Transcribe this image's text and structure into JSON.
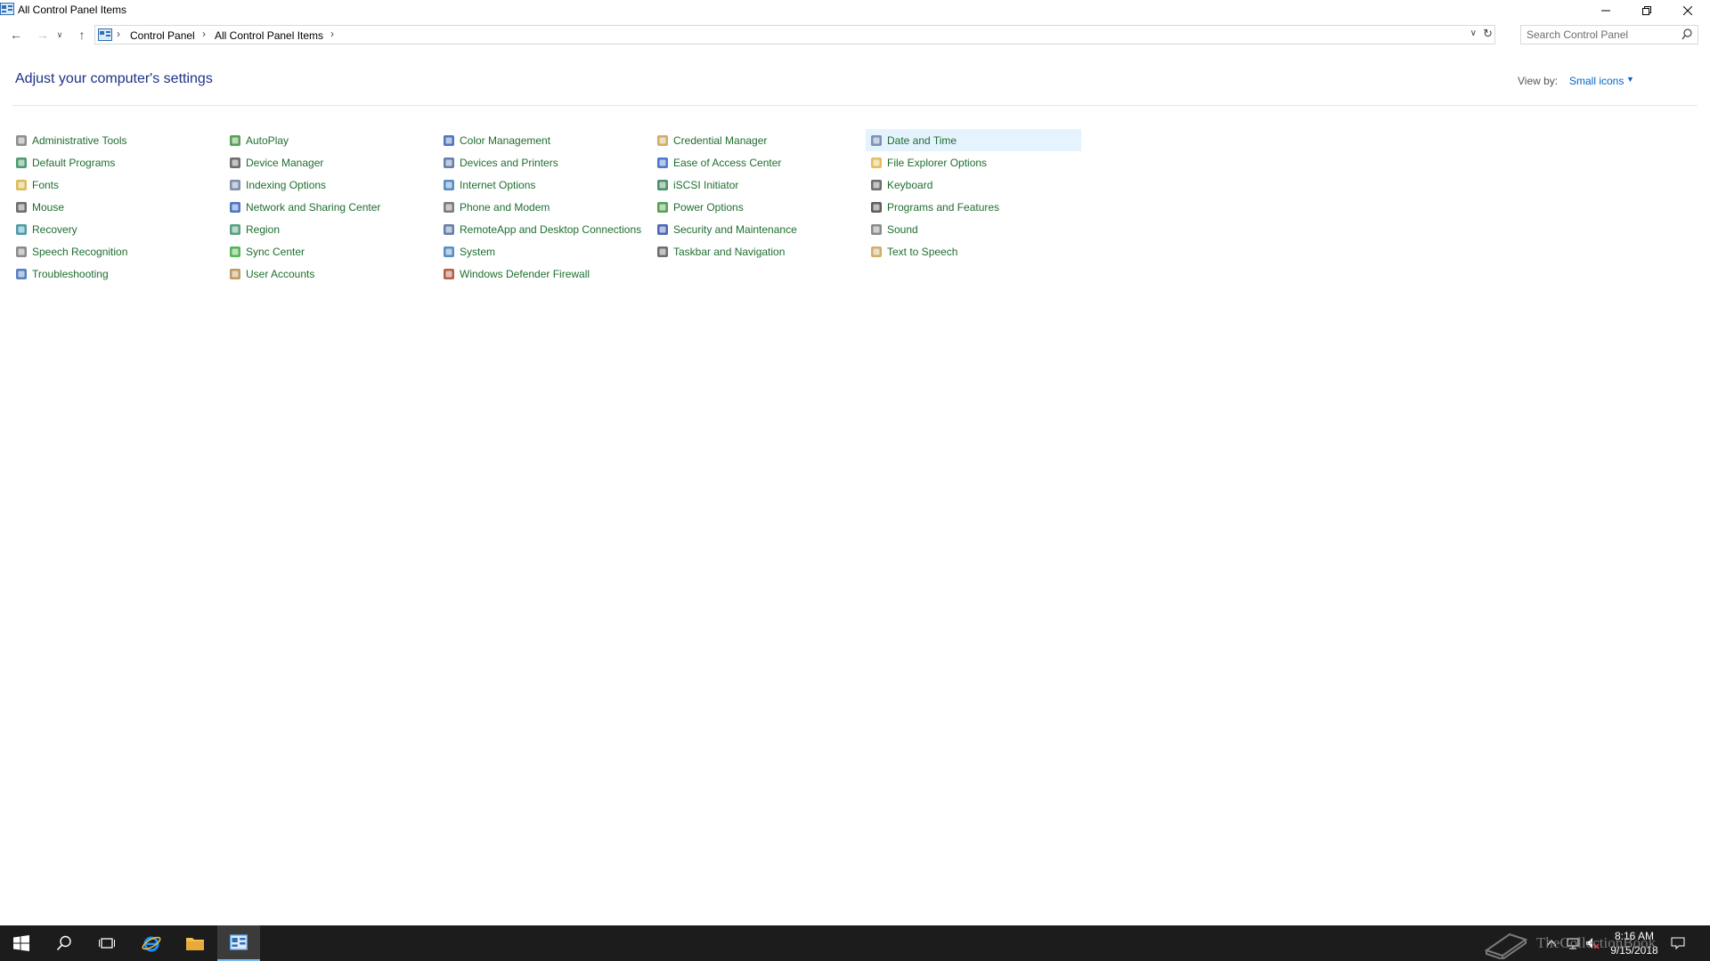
{
  "window": {
    "title": "All Control Panel Items",
    "minimize_label": "—",
    "maximize_label": "❐",
    "close_label": "✕"
  },
  "nav": {
    "back_icon": "←",
    "forward_icon": "→",
    "recent_icon": "∨",
    "up_icon": "↑"
  },
  "address": {
    "breadcrumbs": [
      "Control Panel",
      "All Control Panel Items"
    ],
    "separator": "›",
    "dropdown_icon": "∨",
    "refresh_icon": "↻"
  },
  "search": {
    "placeholder": "Search Control Panel"
  },
  "header": {
    "title": "Adjust your computer's settings",
    "view_by_label": "View by:",
    "view_by_value": "Small icons",
    "view_by_arrow": "▼"
  },
  "items": [
    {
      "label": "Administrative Tools",
      "icon": "administrative-tools-icon",
      "color": "#7a7a7a"
    },
    {
      "label": "AutoPlay",
      "icon": "autoplay-icon",
      "color": "#3a8f3a"
    },
    {
      "label": "Color Management",
      "icon": "color-management-icon",
      "color": "#2f5fb3"
    },
    {
      "label": "Credential Manager",
      "icon": "credential-manager-icon",
      "color": "#c8a04a"
    },
    {
      "label": "Date and Time",
      "icon": "date-and-time-icon",
      "color": "#6a7fa8",
      "selected": true
    },
    {
      "label": "Default Programs",
      "icon": "default-programs-icon",
      "color": "#2e8b57"
    },
    {
      "label": "Device Manager",
      "icon": "device-manager-icon",
      "color": "#555555"
    },
    {
      "label": "Devices and Printers",
      "icon": "devices-and-printers-icon",
      "color": "#4a6a9a"
    },
    {
      "label": "Ease of Access Center",
      "icon": "ease-of-access-icon",
      "color": "#2b63c6"
    },
    {
      "label": "File Explorer Options",
      "icon": "file-explorer-options-icon",
      "color": "#e0b43a"
    },
    {
      "label": "Fonts",
      "icon": "fonts-icon",
      "color": "#d4b23a"
    },
    {
      "label": "Indexing Options",
      "icon": "indexing-options-icon",
      "color": "#6a7a9a"
    },
    {
      "label": "Internet Options",
      "icon": "internet-options-icon",
      "color": "#3a7ab8"
    },
    {
      "label": "iSCSI Initiator",
      "icon": "iscsi-initiator-icon",
      "color": "#2e7d4f"
    },
    {
      "label": "Keyboard",
      "icon": "keyboard-icon",
      "color": "#555555"
    },
    {
      "label": "Mouse",
      "icon": "mouse-icon",
      "color": "#555555"
    },
    {
      "label": "Network and Sharing Center",
      "icon": "network-sharing-icon",
      "color": "#2f5fb3"
    },
    {
      "label": "Phone and Modem",
      "icon": "phone-modem-icon",
      "color": "#666666"
    },
    {
      "label": "Power Options",
      "icon": "power-options-icon",
      "color": "#3a8f3a"
    },
    {
      "label": "Programs and Features",
      "icon": "programs-features-icon",
      "color": "#444444"
    },
    {
      "label": "Recovery",
      "icon": "recovery-icon",
      "color": "#2e8b9a"
    },
    {
      "label": "Region",
      "icon": "region-icon",
      "color": "#3a8f6a"
    },
    {
      "label": "RemoteApp and Desktop Connections",
      "icon": "remoteapp-icon",
      "color": "#4a6a9a"
    },
    {
      "label": "Security and Maintenance",
      "icon": "security-maintenance-icon",
      "color": "#2b4fa8"
    },
    {
      "label": "Sound",
      "icon": "sound-icon",
      "color": "#777777"
    },
    {
      "label": "Speech Recognition",
      "icon": "speech-recognition-icon",
      "color": "#777777"
    },
    {
      "label": "Sync Center",
      "icon": "sync-center-icon",
      "color": "#3aa83a"
    },
    {
      "label": "System",
      "icon": "system-icon",
      "color": "#3a7ab8"
    },
    {
      "label": "Taskbar and Navigation",
      "icon": "taskbar-navigation-icon",
      "color": "#555555"
    },
    {
      "label": "Text to Speech",
      "icon": "text-to-speech-icon",
      "color": "#c8a04a"
    },
    {
      "label": "Troubleshooting",
      "icon": "troubleshooting-icon",
      "color": "#3a6ab8"
    },
    {
      "label": "User Accounts",
      "icon": "user-accounts-icon",
      "color": "#b58a4a"
    },
    {
      "label": "Windows Defender Firewall",
      "icon": "windows-firewall-icon",
      "color": "#a8442a"
    }
  ],
  "taskbar": {
    "buttons": [
      "start-icon",
      "search-icon",
      "task-view-icon",
      "internet-explorer-icon",
      "file-explorer-icon",
      "control-panel-icon"
    ],
    "time": "8:16 AM",
    "date": "9/15/2018",
    "watermark": "TheCollectionBook"
  },
  "colors": {
    "link": "#1e6e2e",
    "heading": "#1e3287",
    "selected_bg": "#e5f3ff",
    "taskbar_bg": "#1c1c1c"
  }
}
